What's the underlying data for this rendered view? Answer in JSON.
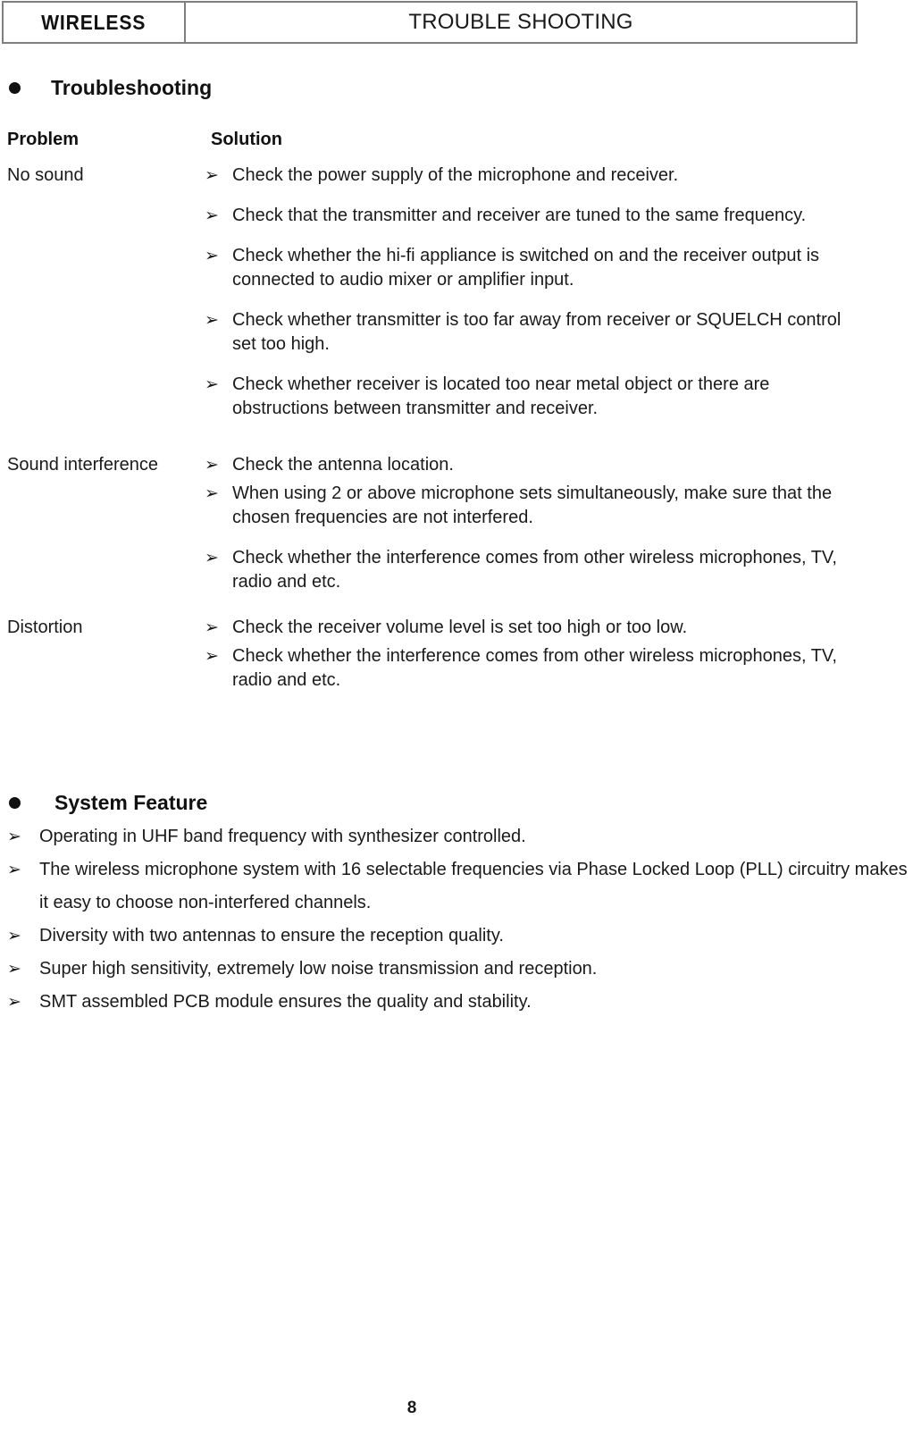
{
  "header": {
    "brand": "WIRELESS",
    "title": "TROUBLE SHOOTING"
  },
  "troubleshooting": {
    "heading": "Troubleshooting",
    "columns": {
      "problem": "Problem",
      "solution": "Solution"
    },
    "bullet_glyph": "➢",
    "rows": [
      {
        "problem": "No sound",
        "solutions": [
          "Check the power supply of the microphone and receiver.",
          "Check that the transmitter and receiver are tuned to the same frequency.",
          "Check whether the hi-fi appliance is switched on and the receiver output is connected to audio mixer or amplifier input.",
          "Check whether transmitter is too far away from receiver or SQUELCH control set too high.",
          "Check whether receiver is located too near metal object or there are obstructions between transmitter and receiver."
        ]
      },
      {
        "problem": "Sound interference",
        "solutions": [
          "Check the antenna location.",
          "When using 2 or above microphone sets simultaneously, make sure that the chosen frequencies are not interfered.",
          "Check whether the interference comes from other wireless microphones, TV, radio and etc."
        ]
      },
      {
        "problem": "Distortion",
        "solutions": [
          "Check the receiver volume level is set too high or too low.",
          "Check whether the interference comes from other wireless microphones, TV, radio and etc."
        ]
      }
    ]
  },
  "system_feature": {
    "heading": "System Feature",
    "bullet_glyph": "➢",
    "items": [
      "Operating in UHF band frequency with synthesizer controlled.",
      "The wireless microphone system with 16 selectable frequencies via Phase Locked Loop (PLL) circuitry makes it easy to choose non-interfered channels.",
      "Diversity with two antennas to ensure the reception quality.",
      "Super high sensitivity, extremely low noise transmission and reception.",
      "SMT assembled PCB module ensures the quality and stability."
    ]
  },
  "footer": {
    "page_number": "8"
  }
}
